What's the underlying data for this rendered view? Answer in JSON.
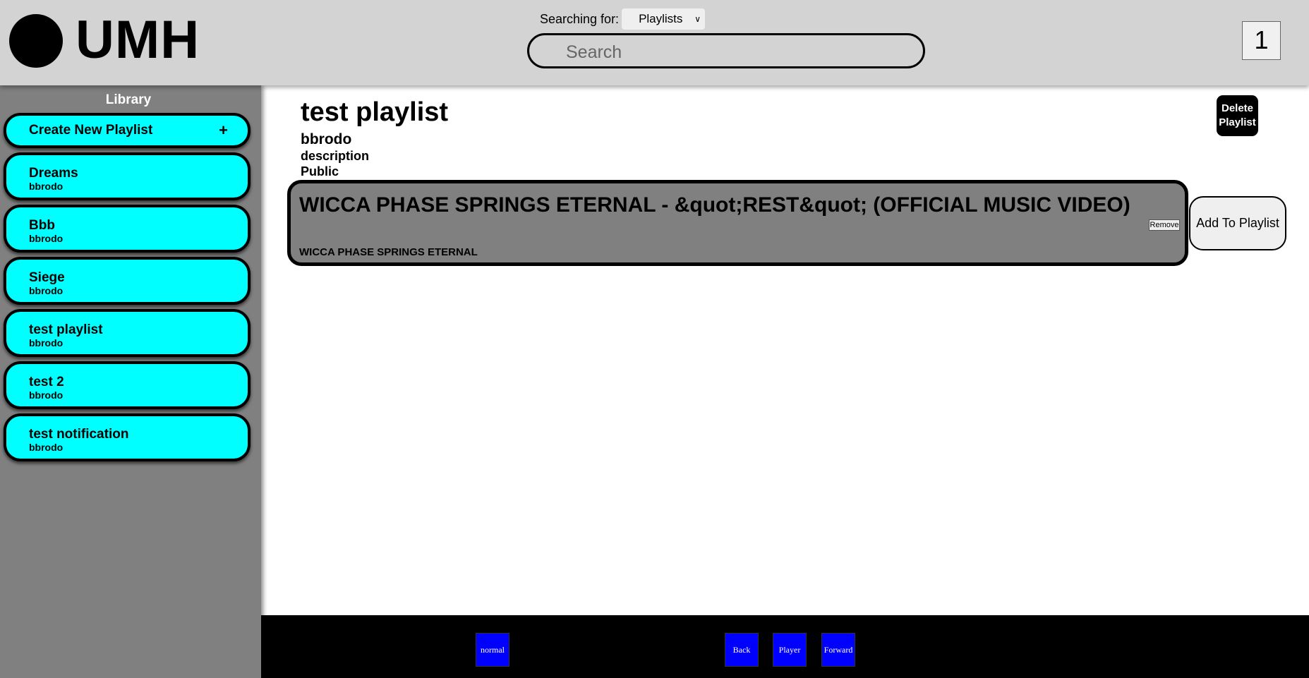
{
  "header": {
    "logo_text": "UMH",
    "searching_for_label": "Searching for:",
    "search_type": "Playlists",
    "search_placeholder": "Search",
    "notification_count": "1"
  },
  "sidebar": {
    "title": "Library",
    "create_label": "Create New Playlist",
    "create_icon": "+",
    "items": [
      {
        "name": "Dreams",
        "owner": "bbrodo"
      },
      {
        "name": "Bbb",
        "owner": "bbrodo"
      },
      {
        "name": "Siege",
        "owner": "bbrodo"
      },
      {
        "name": "test playlist",
        "owner": "bbrodo"
      },
      {
        "name": "test 2",
        "owner": "bbrodo"
      },
      {
        "name": "test notification",
        "owner": "bbrodo"
      }
    ]
  },
  "playlist": {
    "title": "test playlist",
    "owner": "bbrodo",
    "description": "description",
    "visibility": "Public",
    "delete_label_1": "Delete",
    "delete_label_2": "Playlist",
    "songs": [
      {
        "title": "WICCA PHASE SPRINGS ETERNAL - &quot;REST&quot; (OFFICIAL MUSIC VIDEO)",
        "artist": "WICCA PHASE SPRINGS ETERNAL",
        "remove_label": "Remove"
      }
    ],
    "add_label": "Add To Playlist"
  },
  "footer": {
    "mode_label": "normal",
    "back_label": "Back",
    "player_label": "Player",
    "forward_label": "Forward"
  },
  "colors": {
    "header_bg": "#d3d3d3",
    "sidebar_bg": "#808080",
    "playlist_item_bg": "#00ffff",
    "song_card_bg": "#808080",
    "footer_bg": "#000000",
    "footer_button_bg": "#0000ff"
  }
}
